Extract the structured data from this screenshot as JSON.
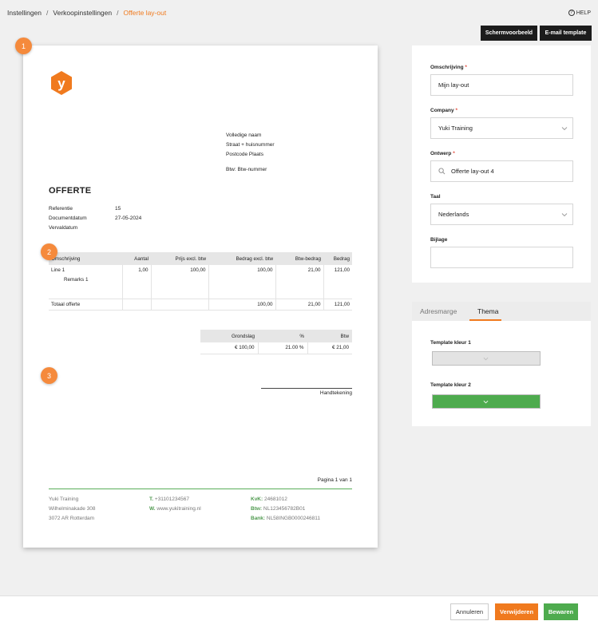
{
  "breadcrumb": {
    "items": [
      "Instellingen",
      "Verkoopinstellingen",
      "Offerte lay-out"
    ],
    "separator": "/"
  },
  "help": {
    "icon": "question-circle-icon",
    "label": "HELP"
  },
  "toolbar": {
    "preview_label": "Schermvoorbeeld",
    "email_label": "E-mail template"
  },
  "markers": [
    "1",
    "2",
    "3"
  ],
  "document": {
    "logo": {
      "icon": "yuki-logo-icon",
      "letter": "y",
      "color": "#f07a1e"
    },
    "address": {
      "name": "Volledige naam",
      "street": "Straat + huisnummer",
      "city": "Postcode Plaats",
      "vat": "Btw: Btw-nummer"
    },
    "title": "OFFERTE",
    "meta": [
      {
        "label": "Referentie",
        "value": "15"
      },
      {
        "label": "Documentdatum",
        "value": "27-05-2024"
      },
      {
        "label": "Vervaldatum",
        "value": ""
      }
    ],
    "lines_table": {
      "headers": [
        "Omschrijving",
        "Aantal",
        "Prijs excl. btw",
        "Bedrag excl. btw",
        "Btw-bedrag",
        "Bedrag"
      ],
      "item": {
        "description": "Line 1",
        "remark": "Remarks 1",
        "quantity": "1,00",
        "price": "100,00",
        "amount_excl": "100,00",
        "vat_amount": "21,00",
        "amount": "121,00"
      },
      "total": {
        "label": "Totaal offerte",
        "amount_excl": "100,00",
        "vat_amount": "21,00",
        "amount": "121,00"
      }
    },
    "vat_table": {
      "headers": [
        "Grondslag",
        "%",
        "Btw"
      ],
      "row": [
        "€ 100,00",
        "21.00 %",
        "€ 21,00"
      ]
    },
    "signature_label": "Handtekening",
    "page_number": "Pagina 1 van 1",
    "footer": {
      "company": "Yuki Training",
      "street": "Wilhelminakade 308",
      "city": "3072 AR Rotterdam",
      "phone_label": "T.",
      "phone": "+31101234567",
      "web_label": "W.",
      "web": "www.yukitraining.nl",
      "kvk_label": "KvK:",
      "kvk": "24681012",
      "btw_label": "Btw:",
      "btw": "NL123456782B01",
      "bank_label": "Bank:",
      "bank": "NL58INGB0000246811"
    }
  },
  "form": {
    "omschrijving": {
      "label": "Omschrijving",
      "value": "Mijn lay-out"
    },
    "company": {
      "label": "Company",
      "value": "Yuki Training"
    },
    "ontwerp": {
      "label": "Ontwerp",
      "value": "Offerte lay-out 4"
    },
    "taal": {
      "label": "Taal",
      "value": "Nederlands"
    },
    "bijlage": {
      "label": "Bijlage",
      "value": ""
    },
    "required_mark": "*"
  },
  "theme": {
    "tabs": [
      "Adresmarge",
      "Thema"
    ],
    "active_tab": "Thema",
    "color1": {
      "label": "Template kleur 1",
      "value": "#e3e3e3"
    },
    "color2": {
      "label": "Template kleur 2",
      "value": "#4eab4e"
    }
  },
  "actions": {
    "cancel_label": "Annuleren",
    "delete_label": "Verwijderen",
    "save_label": "Bewaren"
  },
  "colors": {
    "accent": "#f07a1e",
    "success": "#4eab4e",
    "dark": "#1c1c1c"
  }
}
